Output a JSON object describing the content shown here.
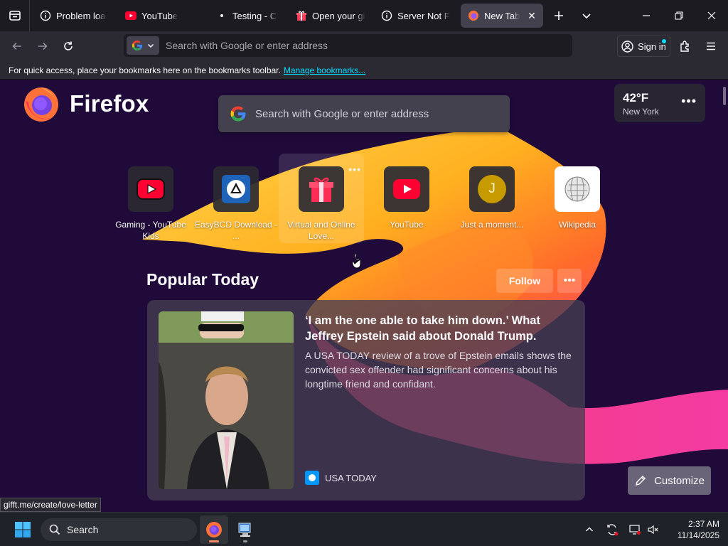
{
  "tabs": [
    {
      "label": "Problem loading page",
      "icon": "info-icon"
    },
    {
      "label": "YouTube",
      "icon": "youtube-icon"
    },
    {
      "label": "Testing - Can You",
      "icon": "dot-icon"
    },
    {
      "label": "Open your gift",
      "icon": "gift-icon"
    },
    {
      "label": "Server Not Found",
      "icon": "info-icon"
    },
    {
      "label": "New Tab",
      "icon": "firefox-icon",
      "active": true
    }
  ],
  "navbar": {
    "url_placeholder": "Search with Google or enter address",
    "sign_in_label": "Sign in"
  },
  "bookmarks_bar": {
    "message": "For quick access, place your bookmarks here on the bookmarks toolbar.",
    "manage_link": "Manage bookmarks..."
  },
  "newtab": {
    "brand": "Firefox",
    "search_placeholder": "Search with Google or enter address",
    "weather": {
      "temperature": "42°F",
      "location": "New York"
    },
    "top_sites": [
      {
        "label": "Gaming - YouTube Kids",
        "icon": "youtube-icon"
      },
      {
        "label": "EasyBCD Download - ...",
        "icon": "easybcd-icon"
      },
      {
        "label": "Virtual and Online Love...",
        "icon": "gift-icon"
      },
      {
        "label": "YouTube",
        "icon": "youtube-icon"
      },
      {
        "label": "Just a moment...",
        "icon": "letter-j-icon",
        "letter": "J"
      },
      {
        "label": "Wikipedia",
        "icon": "wikipedia-icon"
      }
    ],
    "section": {
      "title": "Popular Today",
      "follow_label": "Follow"
    },
    "story": {
      "headline": "‘I am the one able to take him down.’ What Jeffrey Epstein said about Donald Trump.",
      "excerpt": "A USA TODAY review of a trove of Epstein emails shows the convicted sex offender had significant concerns about his longtime friend and confidant.",
      "source": "USA TODAY"
    },
    "customize_label": "Customize"
  },
  "status_url": "gifft.me/create/love-letter",
  "taskbar": {
    "search_label": "Search",
    "time": "2:37 AM",
    "date": "11/14/2025"
  },
  "colors": {
    "accent_link": "#00ddff",
    "content_bg": "#1f0a3a",
    "youtube_red": "#ff0033"
  }
}
